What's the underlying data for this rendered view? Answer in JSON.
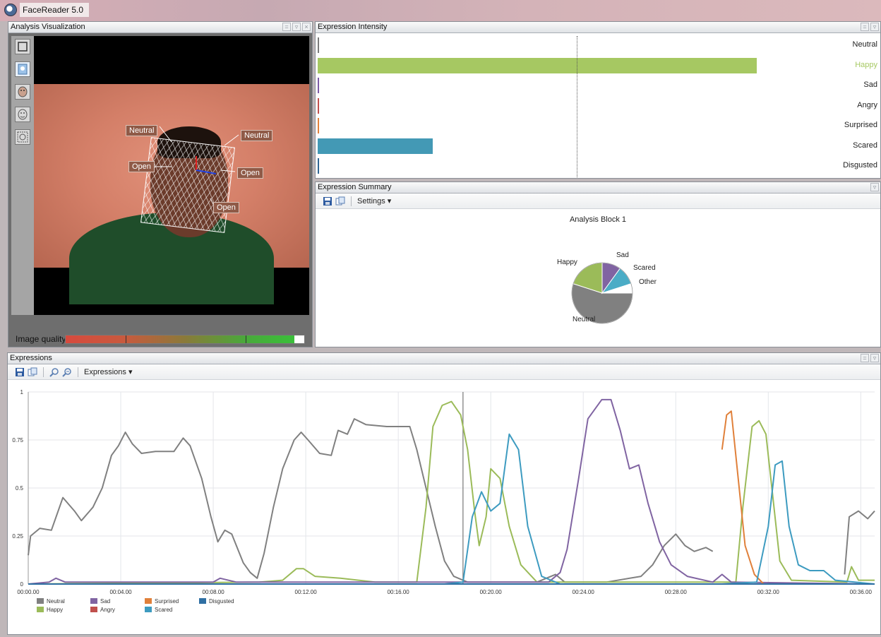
{
  "window": {
    "title": "FaceReader 5.0"
  },
  "visualization": {
    "title": "Analysis Visualization",
    "face_labels": {
      "left_eye": "Neutral",
      "right_eye": "Neutral",
      "left_mouth": "Open",
      "right_mouth": "Open",
      "jaw": "Open"
    },
    "image_quality_label": "Image quality",
    "image_quality_level": 0.96,
    "tools": [
      "frame-tool-icon",
      "face-box-icon",
      "face-model-icon",
      "landmarks-icon",
      "mesh-icon"
    ]
  },
  "intensity": {
    "title": "Expression Intensity",
    "rows": [
      {
        "label": "Neutral",
        "value": 0.0,
        "color": "#7a7a7a"
      },
      {
        "label": "Happy",
        "value": 0.84,
        "color": "#a6c862",
        "label_color": "#a6c862"
      },
      {
        "label": "Sad",
        "value": 0.0,
        "color": "#7d5aa6"
      },
      {
        "label": "Angry",
        "value": 0.0,
        "color": "#c0504d"
      },
      {
        "label": "Surprised",
        "value": 0.0,
        "color": "#e1813a"
      },
      {
        "label": "Scared",
        "value": 0.22,
        "color": "#4399b5"
      },
      {
        "label": "Disgusted",
        "value": 0.0,
        "color": "#2f6694"
      }
    ]
  },
  "summary": {
    "title": "Expression Summary",
    "settings_label": "Settings ▾",
    "pie_title": "Analysis Block 1",
    "slices": [
      {
        "label": "Neutral",
        "value": 55,
        "color": "#808080"
      },
      {
        "label": "Happy",
        "value": 20,
        "color": "#9bbb59"
      },
      {
        "label": "Sad",
        "value": 10,
        "color": "#8064a2"
      },
      {
        "label": "Scared",
        "value": 10,
        "color": "#4bacc6"
      },
      {
        "label": "Other",
        "value": 5,
        "color": "#ffffff"
      }
    ]
  },
  "expressions": {
    "title": "Expressions",
    "menu_label": "Expressions ▾",
    "legend": [
      {
        "name": "Neutral",
        "color": "#808080"
      },
      {
        "name": "Sad",
        "color": "#8064a2"
      },
      {
        "name": "Surprised",
        "color": "#e0803a"
      },
      {
        "name": "Disgusted",
        "color": "#2f6fa3"
      },
      {
        "name": "Happy",
        "color": "#9bbb59"
      },
      {
        "name": "Angry",
        "color": "#c0504d"
      },
      {
        "name": "Scared",
        "color": "#3d9bc0"
      }
    ]
  },
  "chart_data": {
    "type": "line",
    "xlim": [
      0,
      36.6
    ],
    "ylim": [
      0,
      1
    ],
    "y_ticks": [
      0,
      0.25,
      0.5,
      0.75,
      1
    ],
    "y_tick_labels": [
      "0",
      "0.25",
      "0.5",
      "0.75",
      "1"
    ],
    "x_ticks": [
      0,
      4,
      8,
      12,
      16,
      20,
      24,
      28,
      32,
      36
    ],
    "x_tick_labels": [
      "00:00.00",
      "00:04.00",
      "00:08.00",
      "00:12.00",
      "00:16.00",
      "00:20.00",
      "00:24.00",
      "00:28.00",
      "00:32.00",
      "00:36.00"
    ],
    "cursor_x": 18.8,
    "grid": true,
    "series": [
      {
        "name": "Neutral",
        "color": "#808080",
        "points": [
          [
            0,
            0.15
          ],
          [
            0.1,
            0.25
          ],
          [
            0.5,
            0.29
          ],
          [
            1.0,
            0.28
          ],
          [
            1.5,
            0.45
          ],
          [
            2.0,
            0.38
          ],
          [
            2.3,
            0.33
          ],
          [
            2.8,
            0.4
          ],
          [
            3.2,
            0.5
          ],
          [
            3.6,
            0.67
          ],
          [
            3.9,
            0.72
          ],
          [
            4.2,
            0.79
          ],
          [
            4.5,
            0.73
          ],
          [
            4.9,
            0.68
          ],
          [
            5.5,
            0.69
          ],
          [
            6.0,
            0.69
          ],
          [
            6.3,
            0.69
          ],
          [
            6.7,
            0.76
          ],
          [
            7.0,
            0.72
          ],
          [
            7.5,
            0.55
          ],
          [
            7.9,
            0.35
          ],
          [
            8.2,
            0.22
          ],
          [
            8.5,
            0.28
          ],
          [
            8.8,
            0.26
          ],
          [
            9.1,
            0.17
          ],
          [
            9.3,
            0.11
          ],
          [
            9.6,
            0.06
          ],
          [
            9.9,
            0.03
          ],
          [
            10.2,
            0.16
          ],
          [
            10.6,
            0.4
          ],
          [
            11.0,
            0.6
          ],
          [
            11.5,
            0.75
          ],
          [
            11.8,
            0.79
          ],
          [
            12.1,
            0.75
          ],
          [
            12.6,
            0.68
          ],
          [
            13.1,
            0.67
          ],
          [
            13.4,
            0.8
          ],
          [
            13.8,
            0.78
          ],
          [
            14.1,
            0.86
          ],
          [
            14.6,
            0.83
          ],
          [
            15.5,
            0.82
          ],
          [
            16.5,
            0.82
          ],
          [
            16.8,
            0.7
          ],
          [
            17.2,
            0.5
          ],
          [
            17.6,
            0.3
          ],
          [
            18.0,
            0.12
          ],
          [
            18.4,
            0.04
          ],
          [
            19.0,
            0.01
          ],
          [
            22.0,
            0.01
          ],
          [
            22.8,
            0.05
          ],
          [
            23.2,
            0.01
          ],
          [
            25.0,
            0.01
          ],
          [
            26.5,
            0.04
          ],
          [
            27.0,
            0.1
          ],
          [
            27.5,
            0.2
          ],
          [
            28.0,
            0.26
          ],
          [
            28.4,
            0.2
          ],
          [
            28.8,
            0.17
          ],
          [
            29.3,
            0.19
          ],
          [
            29.6,
            0.17
          ]
        ]
      },
      {
        "name": "Neutral",
        "color": "#808080",
        "points": [
          [
            35.3,
            0.05
          ],
          [
            35.5,
            0.35
          ],
          [
            35.9,
            0.38
          ],
          [
            36.3,
            0.34
          ],
          [
            36.6,
            0.38
          ]
        ]
      },
      {
        "name": "Happy",
        "color": "#9bbb59",
        "points": [
          [
            0,
            0.0
          ],
          [
            10.0,
            0.01
          ],
          [
            11.0,
            0.02
          ],
          [
            11.6,
            0.08
          ],
          [
            11.9,
            0.08
          ],
          [
            12.4,
            0.04
          ],
          [
            13.5,
            0.03
          ],
          [
            15.0,
            0.01
          ],
          [
            16.8,
            0.01
          ],
          [
            17.2,
            0.4
          ],
          [
            17.5,
            0.82
          ],
          [
            17.9,
            0.93
          ],
          [
            18.3,
            0.95
          ],
          [
            18.7,
            0.88
          ],
          [
            19.0,
            0.7
          ],
          [
            19.3,
            0.38
          ],
          [
            19.5,
            0.2
          ],
          [
            19.8,
            0.35
          ],
          [
            20.0,
            0.6
          ],
          [
            20.4,
            0.55
          ],
          [
            20.8,
            0.3
          ],
          [
            21.3,
            0.1
          ],
          [
            22.0,
            0.01
          ],
          [
            30.6,
            0.01
          ],
          [
            30.9,
            0.4
          ],
          [
            31.3,
            0.82
          ],
          [
            31.6,
            0.85
          ],
          [
            31.9,
            0.78
          ],
          [
            32.2,
            0.45
          ],
          [
            32.5,
            0.12
          ],
          [
            33.0,
            0.02
          ],
          [
            35.4,
            0.01
          ],
          [
            35.6,
            0.09
          ],
          [
            35.9,
            0.02
          ],
          [
            36.6,
            0.02
          ]
        ]
      },
      {
        "name": "Sad",
        "color": "#8064a2",
        "points": [
          [
            0,
            0.0
          ],
          [
            0.9,
            0.01
          ],
          [
            1.2,
            0.03
          ],
          [
            1.6,
            0.01
          ],
          [
            8.0,
            0.01
          ],
          [
            8.3,
            0.03
          ],
          [
            9.0,
            0.01
          ],
          [
            17.5,
            0.01
          ],
          [
            22.5,
            0.01
          ],
          [
            23.0,
            0.06
          ],
          [
            23.3,
            0.18
          ],
          [
            23.8,
            0.55
          ],
          [
            24.2,
            0.86
          ],
          [
            24.8,
            0.96
          ],
          [
            25.2,
            0.96
          ],
          [
            25.6,
            0.8
          ],
          [
            26.0,
            0.6
          ],
          [
            26.4,
            0.62
          ],
          [
            26.8,
            0.42
          ],
          [
            27.3,
            0.22
          ],
          [
            27.8,
            0.1
          ],
          [
            28.5,
            0.04
          ],
          [
            29.6,
            0.01
          ],
          [
            30.0,
            0.05
          ],
          [
            30.4,
            0.01
          ],
          [
            36.6,
            0.0
          ]
        ]
      },
      {
        "name": "Surprised",
        "color": "#e0803a",
        "points": [
          [
            30.0,
            0.7
          ],
          [
            30.2,
            0.88
          ],
          [
            30.4,
            0.9
          ],
          [
            30.7,
            0.55
          ],
          [
            31.0,
            0.2
          ],
          [
            31.4,
            0.05
          ],
          [
            31.8,
            0.0
          ]
        ]
      },
      {
        "name": "Scared",
        "color": "#3d9bc0",
        "points": [
          [
            0,
            0.0
          ],
          [
            18.0,
            0.0
          ],
          [
            18.8,
            0.01
          ],
          [
            19.2,
            0.35
          ],
          [
            19.6,
            0.48
          ],
          [
            20.0,
            0.38
          ],
          [
            20.4,
            0.42
          ],
          [
            20.8,
            0.78
          ],
          [
            21.2,
            0.7
          ],
          [
            21.6,
            0.3
          ],
          [
            22.2,
            0.04
          ],
          [
            23.0,
            0.0
          ],
          [
            30.0,
            0.0
          ],
          [
            31.5,
            0.01
          ],
          [
            32.0,
            0.3
          ],
          [
            32.3,
            0.62
          ],
          [
            32.6,
            0.64
          ],
          [
            32.9,
            0.3
          ],
          [
            33.3,
            0.1
          ],
          [
            33.8,
            0.07
          ],
          [
            34.4,
            0.07
          ],
          [
            34.9,
            0.02
          ],
          [
            36.6,
            0.0
          ]
        ]
      },
      {
        "name": "Disgusted",
        "color": "#2f6fa3",
        "points": [
          [
            0,
            0.0
          ],
          [
            36.6,
            0.0
          ]
        ]
      }
    ]
  }
}
